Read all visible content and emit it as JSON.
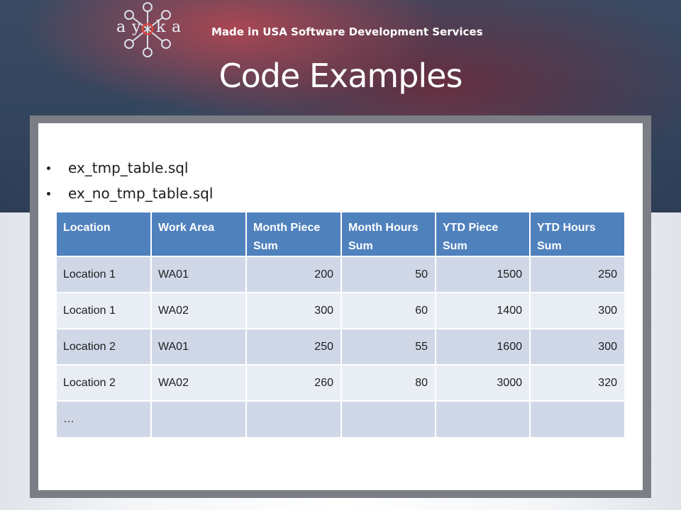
{
  "header": {
    "logo_letters": [
      "a",
      "y",
      "k",
      "a"
    ],
    "tagline": "Made in USA Software Development Services"
  },
  "slide": {
    "title": "Code Examples",
    "bullets": [
      "ex_tmp_table.sql",
      "ex_no_tmp_table.sql"
    ]
  },
  "table": {
    "columns": [
      "Location",
      "Work Area",
      "Month Piece Sum",
      "Month Hours Sum",
      "YTD Piece Sum",
      "YTD Hours Sum"
    ],
    "rows": [
      [
        "Location 1",
        "WA01",
        "200",
        "50",
        "1500",
        "250"
      ],
      [
        "Location 1",
        "WA02",
        "300",
        "60",
        "1400",
        "300"
      ],
      [
        "Location 2",
        "WA01",
        "250",
        "55",
        "1600",
        "300"
      ],
      [
        "Location 2",
        "WA02",
        "260",
        "80",
        "3000",
        "320"
      ],
      [
        "…",
        "",
        "",
        "",
        "",
        ""
      ]
    ]
  },
  "colors": {
    "header_cell": "#4f81bd",
    "row_odd": "#d0d8e8",
    "row_even": "#e9edf4",
    "panel_frame": "#7b7f85"
  }
}
